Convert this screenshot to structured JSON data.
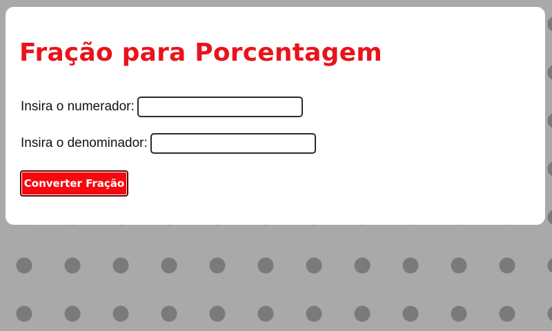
{
  "page": {
    "title": "Fração para Porcentagem"
  },
  "form": {
    "numerator_label": "Insira o numerador:",
    "numerator_value": "",
    "denominator_label": "Insira o denominador:",
    "denominator_value": "",
    "convert_button_label": "Converter Fração"
  },
  "colors": {
    "accent": "#e8141c",
    "button_bg": "#f5090f",
    "card_bg": "#ffffff",
    "background_pattern": "#9b9b9b"
  },
  "icons": {
    "background": "calculator-pattern"
  }
}
